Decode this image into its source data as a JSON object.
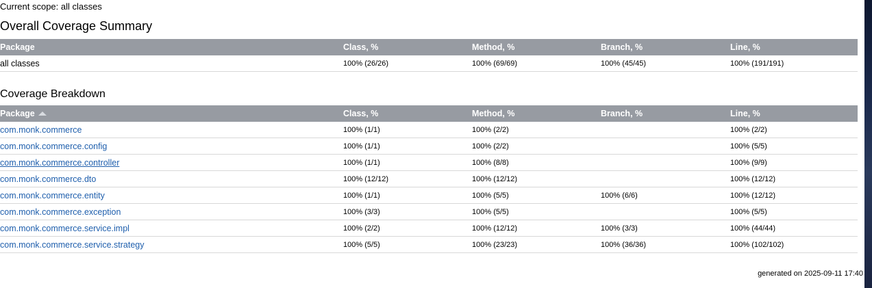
{
  "scope_text": "Current scope: all classes",
  "summary": {
    "title": "Overall Coverage Summary",
    "headers": [
      "Package",
      "Class, %",
      "Method, %",
      "Branch, %",
      "Line, %"
    ],
    "row": {
      "package": "all classes",
      "class": "100% (26/26)",
      "method": "100% (69/69)",
      "branch": "100% (45/45)",
      "line": "100% (191/191)"
    }
  },
  "breakdown": {
    "title": "Coverage Breakdown",
    "headers": [
      "Package",
      "Class, %",
      "Method, %",
      "Branch, %",
      "Line, %"
    ],
    "sort_icon": "sort-ascending-icon",
    "rows": [
      {
        "package": "com.monk.commerce",
        "class": "100% (1/1)",
        "method": "100% (2/2)",
        "branch": "",
        "line": "100% (2/2)"
      },
      {
        "package": "com.monk.commerce.config",
        "class": "100% (1/1)",
        "method": "100% (2/2)",
        "branch": "",
        "line": "100% (5/5)"
      },
      {
        "package": "com.monk.commerce.controller",
        "class": "100% (1/1)",
        "method": "100% (8/8)",
        "branch": "",
        "line": "100% (9/9)"
      },
      {
        "package": "com.monk.commerce.dto",
        "class": "100% (12/12)",
        "method": "100% (12/12)",
        "branch": "",
        "line": "100% (12/12)"
      },
      {
        "package": "com.monk.commerce.entity",
        "class": "100% (1/1)",
        "method": "100% (5/5)",
        "branch": "100% (6/6)",
        "line": "100% (12/12)"
      },
      {
        "package": "com.monk.commerce.exception",
        "class": "100% (3/3)",
        "method": "100% (5/5)",
        "branch": "",
        "line": "100% (5/5)"
      },
      {
        "package": "com.monk.commerce.service.impl",
        "class": "100% (2/2)",
        "method": "100% (12/12)",
        "branch": "100% (3/3)",
        "line": "100% (44/44)"
      },
      {
        "package": "com.monk.commerce.service.strategy",
        "class": "100% (5/5)",
        "method": "100% (23/23)",
        "branch": "100% (36/36)",
        "line": "100% (102/102)"
      }
    ]
  },
  "footer": "generated on 2025-09-11 17:40",
  "colors": {
    "header_bg": "#979ba2",
    "link": "#1f5fad",
    "row_border": "#d8d8d8"
  }
}
